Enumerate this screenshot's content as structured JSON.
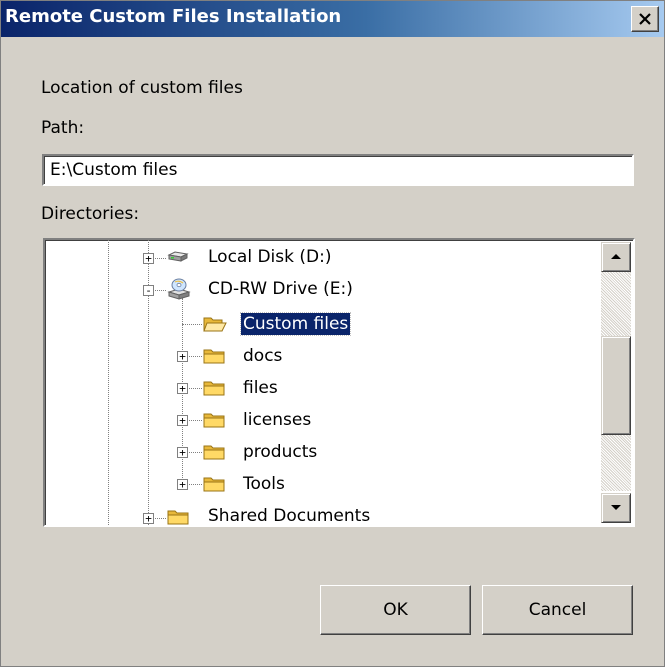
{
  "window": {
    "title": "Remote Custom Files Installation"
  },
  "labels": {
    "location": "Location of custom files",
    "path": "Path:",
    "directories": "Directories:"
  },
  "path_field": {
    "value": "E:\\Custom files"
  },
  "tree": {
    "nodes": [
      {
        "label": "Local Disk (D:)",
        "icon": "hard-drive-icon",
        "expander": "+"
      },
      {
        "label": "CD-RW Drive (E:)",
        "icon": "cd-drive-icon",
        "expander": "-"
      },
      {
        "label": "Custom files",
        "icon": "open-folder-icon",
        "selected": true
      },
      {
        "label": "docs",
        "icon": "folder-icon",
        "expander": "+"
      },
      {
        "label": "files",
        "icon": "folder-icon",
        "expander": "+"
      },
      {
        "label": "licenses",
        "icon": "folder-icon",
        "expander": "+"
      },
      {
        "label": "products",
        "icon": "folder-icon",
        "expander": "+"
      },
      {
        "label": "Tools",
        "icon": "folder-icon",
        "expander": "+"
      },
      {
        "label": "Shared Documents",
        "icon": "folder-icon",
        "expander": "+"
      }
    ]
  },
  "buttons": {
    "ok": "OK",
    "cancel": "Cancel"
  },
  "colors": {
    "titlebar_start": "#0a246a",
    "titlebar_end": "#a6caf0",
    "selection": "#0a246a",
    "face": "#d4d0c8"
  }
}
